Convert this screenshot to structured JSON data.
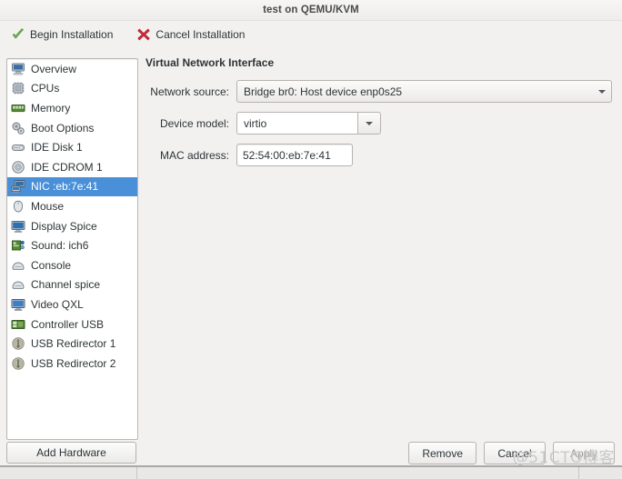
{
  "window": {
    "title": "test on QEMU/KVM"
  },
  "toolbar": {
    "begin_installation": "Begin Installation",
    "cancel_installation": "Cancel Installation",
    "begin_icon": "green-check-icon",
    "cancel_icon": "red-x-icon"
  },
  "sidebar": {
    "items": [
      {
        "label": "Overview",
        "icon": "computer-icon",
        "selected": false
      },
      {
        "label": "CPUs",
        "icon": "cpu-chip-icon",
        "selected": false
      },
      {
        "label": "Memory",
        "icon": "memory-module-icon",
        "selected": false
      },
      {
        "label": "Boot Options",
        "icon": "gears-icon",
        "selected": false
      },
      {
        "label": "IDE Disk 1",
        "icon": "harddisk-icon",
        "selected": false
      },
      {
        "label": "IDE CDROM 1",
        "icon": "cdrom-icon",
        "selected": false
      },
      {
        "label": "NIC :eb:7e:41",
        "icon": "network-card-icon",
        "selected": true
      },
      {
        "label": "Mouse",
        "icon": "mouse-icon",
        "selected": false
      },
      {
        "label": "Display Spice",
        "icon": "display-icon",
        "selected": false
      },
      {
        "label": "Sound: ich6",
        "icon": "sound-card-icon",
        "selected": false
      },
      {
        "label": "Console",
        "icon": "console-icon",
        "selected": false
      },
      {
        "label": "Channel spice",
        "icon": "channel-icon",
        "selected": false
      },
      {
        "label": "Video QXL",
        "icon": "video-icon",
        "selected": false
      },
      {
        "label": "Controller USB",
        "icon": "usb-controller-icon",
        "selected": false
      },
      {
        "label": "USB Redirector 1",
        "icon": "usb-redirector-icon",
        "selected": false
      },
      {
        "label": "USB Redirector 2",
        "icon": "usb-redirector-icon",
        "selected": false
      }
    ],
    "add_hardware": "Add Hardware"
  },
  "panel": {
    "title": "Virtual Network Interface",
    "network_source": {
      "label": "Network source:",
      "value": "Bridge br0: Host device enp0s25"
    },
    "device_model": {
      "label": "Device model:",
      "value": "virtio"
    },
    "mac_address": {
      "label": "MAC address:",
      "value": "52:54:00:eb:7e:41"
    }
  },
  "actions": {
    "remove": "Remove",
    "cancel": "Cancel",
    "apply": "Apply"
  },
  "watermark": {
    "text": "@51CTO博客"
  },
  "colors": {
    "selection_blue": "#4a90d9",
    "window_bg": "#f2f1f0",
    "entry_bg": "#ffffff",
    "text": "#2e3436",
    "check_green": "#73b355",
    "cancel_red": "#cc2a36"
  }
}
